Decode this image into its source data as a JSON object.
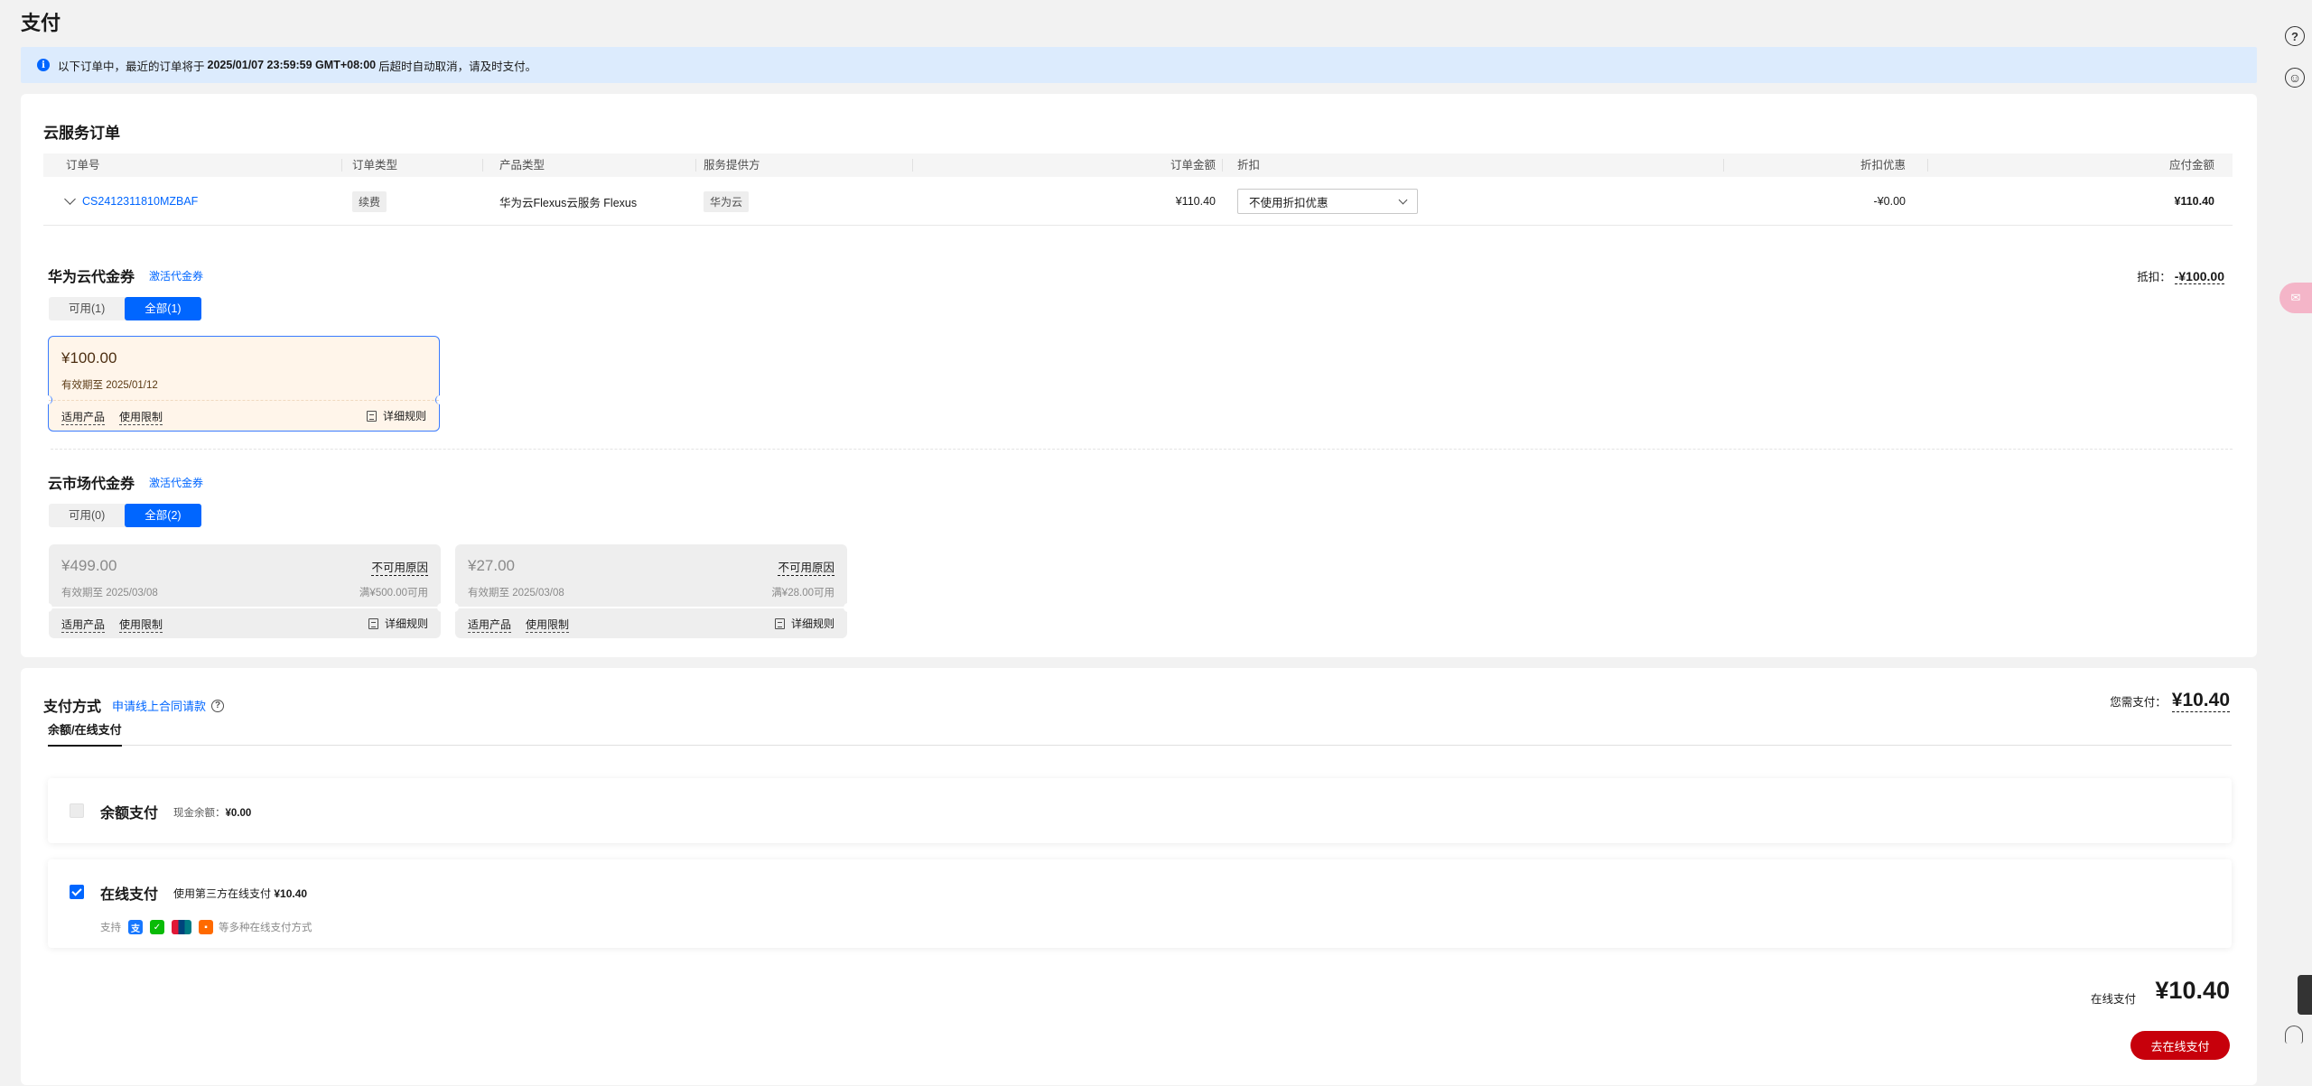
{
  "page": {
    "title": "支付"
  },
  "notice": {
    "prefix": "以下订单中，最近的订单将于",
    "deadline": "2025/01/07 23:59:59 GMT+08:00",
    "suffix": "后超时自动取消，请及时支付。"
  },
  "orders": {
    "section_title": "云服务订单",
    "columns": {
      "order_no": "订单号",
      "order_type": "订单类型",
      "product_type": "产品类型",
      "provider": "服务提供方",
      "amount": "订单金额",
      "discount": "折扣",
      "discount_off": "折扣优惠",
      "payable": "应付金额"
    },
    "rows": [
      {
        "order_no": "CS2412311810MZBAF",
        "order_type": "续费",
        "product_type": "华为云Flexus云服务 Flexus",
        "provider": "华为云",
        "amount": "¥110.40",
        "discount_select": "不使用折扣优惠",
        "discount_off": "-¥0.00",
        "payable": "¥110.40"
      }
    ]
  },
  "hw_vouchers": {
    "title": "华为云代金券",
    "activate": "激活代金券",
    "deduct_label": "抵扣：",
    "deduct_value": "-¥100.00",
    "tabs": [
      "可用(1)",
      "全部(1)"
    ],
    "active_tab": 1,
    "items": [
      {
        "amount": "¥100.00",
        "valid": "有效期至 2025/01/12",
        "products": "适用产品",
        "limits": "使用限制",
        "rules": "详细规则"
      }
    ]
  },
  "market_vouchers": {
    "title": "云市场代金券",
    "activate": "激活代金券",
    "tabs": [
      "可用(0)",
      "全部(2)"
    ],
    "active_tab": 1,
    "items": [
      {
        "amount": "¥499.00",
        "reason": "不可用原因",
        "valid": "有效期至 2025/03/08",
        "condition": "满¥500.00可用",
        "products": "适用产品",
        "limits": "使用限制",
        "rules": "详细规则"
      },
      {
        "amount": "¥27.00",
        "reason": "不可用原因",
        "valid": "有效期至 2025/03/08",
        "condition": "满¥28.00可用",
        "products": "适用产品",
        "limits": "使用限制",
        "rules": "详细规则"
      }
    ]
  },
  "payment": {
    "title": "支付方式",
    "contract_link": "申请线上合同请款",
    "need_pay_label": "您需支付：",
    "need_pay_value": "¥10.40",
    "tab": "余额/在线支付",
    "balance": {
      "name": "余额支付",
      "desc_label": "现金余额：",
      "desc_value": "¥0.00",
      "checked": false
    },
    "online": {
      "name": "在线支付",
      "desc_prefix": "使用第三方在线支付",
      "desc_value": "¥10.40",
      "support_label": "支持",
      "support_more": "等多种在线支付方式",
      "checked": true,
      "methods": [
        "alipay-icon",
        "wechat-pay-icon",
        "unionpay-icon",
        "more-pay-icon"
      ]
    },
    "total_label": "在线支付",
    "total_value": "¥10.40",
    "submit": "去在线支付"
  },
  "colors": {
    "primary": "#0066ff",
    "danger": "#c7000b",
    "notice_bg": "#dcebfd"
  }
}
